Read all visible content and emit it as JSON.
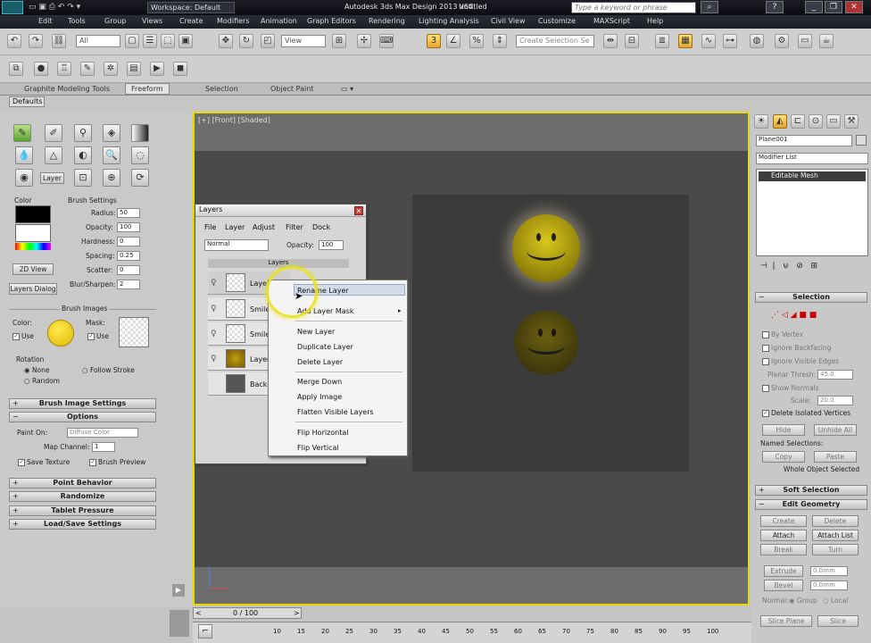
{
  "titlebar": {
    "workspace": "Workspace: Default",
    "title": "Autodesk 3ds Max Design 2013 x64",
    "doc": "Untitled",
    "search_placeholder": "Type a keyword or phrase"
  },
  "menu": [
    "Edit",
    "Tools",
    "Group",
    "Views",
    "Create",
    "Modifiers",
    "Animation",
    "Graph Editors",
    "Rendering",
    "Lighting Analysis",
    "Civil View",
    "Customize",
    "MAXScript",
    "Help"
  ],
  "toolbar": {
    "filter_value": "All",
    "view_value": "View",
    "selection_set_placeholder": "Create Selection Se"
  },
  "ribbon": {
    "tabs": [
      "Graphite Modeling Tools",
      "Freeform",
      "Selection",
      "Object Paint"
    ],
    "active": "Freeform",
    "defaults": "Defaults"
  },
  "left": {
    "layer_btn": "Layer",
    "color_label": "Color",
    "brush_settings": "Brush Settings",
    "fields": [
      {
        "label": "Radius:",
        "value": "50"
      },
      {
        "label": "Opacity:",
        "value": "100"
      },
      {
        "label": "Hardness:",
        "value": "0"
      },
      {
        "label": "Spacing:",
        "value": "0.25"
      },
      {
        "label": "Scatter:",
        "value": "0"
      },
      {
        "label": "Blur/Sharpen:",
        "value": "2"
      }
    ],
    "swap_label": "2D View",
    "layers_dialog": "Layers Dialog",
    "brush_images": "Brush Images",
    "bi_color": "Color:",
    "bi_mask": "Mask:",
    "bi_use": "Use",
    "rotation": "Rotation",
    "rot_none": "None",
    "rot_random": "Random",
    "rot_follow": "Follow Stroke",
    "brush_image_settings": "Brush Image Settings",
    "options": "Options",
    "paint_on": "Paint On:",
    "paint_on_value": "Diffuse Color",
    "map_channel": "Map Channel:",
    "map_channel_value": "1",
    "save_texture": "Save Texture",
    "brush_preview": "Brush Preview",
    "rollouts": [
      "Point Behavior",
      "Randomize",
      "Tablet Pressure",
      "Load/Save Settings"
    ]
  },
  "viewport": {
    "label": "[+] [Front] [Shaded]"
  },
  "layers_window": {
    "title": "Layers",
    "menu": [
      "File",
      "Layer",
      "Adjust",
      "Filter",
      "Dock"
    ],
    "blend": "Normal",
    "opacity_label": "Opacity:",
    "opacity_value": "100",
    "list_header": "Layers",
    "rows": [
      "Layer",
      "Smiley",
      "Smiley",
      "Layer",
      "Backg"
    ]
  },
  "context_menu": {
    "items": [
      "Rename Layer",
      "Add Layer Mask",
      "New Layer",
      "Duplicate Layer",
      "Delete Layer",
      "Merge Down",
      "Apply Image",
      "Flatten Visible Layers",
      "Flip Horizontal",
      "Flip Vertical"
    ]
  },
  "right": {
    "object_name": "Plane001",
    "modifier_list": "Modifier List",
    "stack_item": "Editable Mesh",
    "selection": "Selection",
    "by_vertex": "By Vertex",
    "ignore_backfacing": "Ignore Backfacing",
    "ignore_visible_edges": "Ignore Visible Edges",
    "planar_thresh": "Planar Thresh:",
    "planar_thresh_value": "45.0",
    "show_normals": "Show Normals",
    "scale_label": "Scale:",
    "scale_value": "20.0",
    "delete_isolated": "Delete Isolated Vertices",
    "hide": "Hide",
    "unhide_all": "Unhide All",
    "named_selections": "Named Selections:",
    "copy": "Copy",
    "paste": "Paste",
    "whole_object": "Whole Object Selected",
    "soft_selection": "Soft Selection",
    "edit_geometry": "Edit Geometry",
    "create": "Create",
    "delete": "Delete",
    "attach": "Attach",
    "attach_list": "Attach List",
    "break": "Break",
    "turn": "Turn",
    "extrude": "Extrude",
    "extrude_value": "0.0mm",
    "bevel": "Bevel",
    "bevel_value": "0.0mm",
    "normal": "Normal:",
    "group": "Group",
    "local": "Local",
    "slice_plane": "Slice Plane",
    "slice": "Slice"
  },
  "timeline": {
    "frame": "0 / 100",
    "ticks": [
      "10",
      "15",
      "20",
      "25",
      "30",
      "35",
      "40",
      "45",
      "50",
      "55",
      "60",
      "65",
      "70",
      "75",
      "80",
      "85",
      "90",
      "95",
      "100"
    ]
  }
}
